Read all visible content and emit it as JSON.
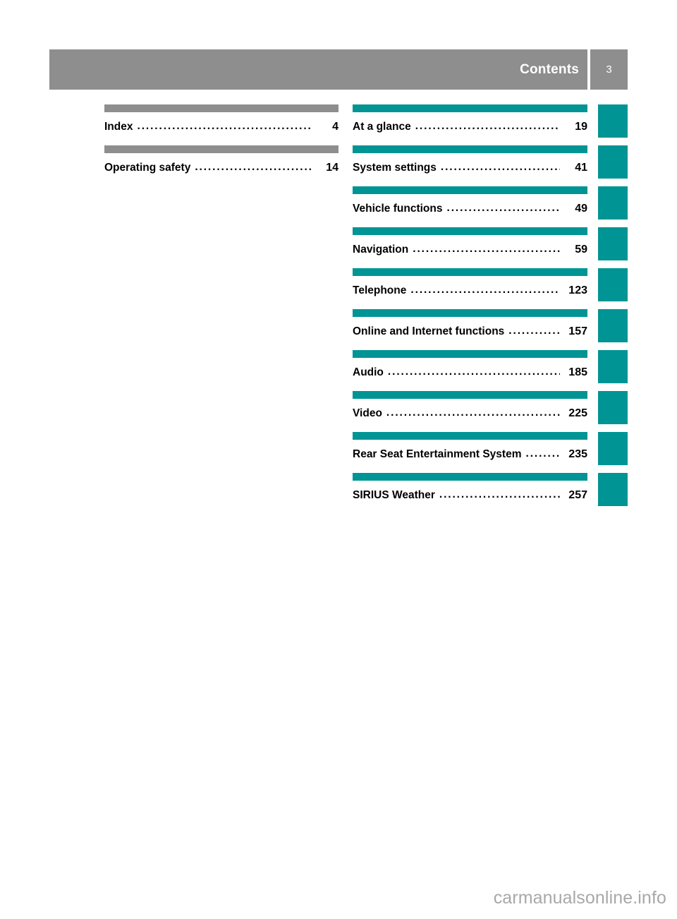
{
  "header": {
    "title": "Contents",
    "page_number": "3",
    "bar_color": "#8e8e8e",
    "text_color": "#ffffff"
  },
  "colors": {
    "gray_rule": "#8e8e8e",
    "teal_rule": "#009494",
    "tab_marker": "#009494",
    "text": "#000000",
    "watermark": "#a8a8a8"
  },
  "toc": {
    "dot_leader": "..............................................................",
    "left_column": [
      {
        "label": "Index",
        "page": "4",
        "rule_color": "#8e8e8e"
      },
      {
        "label": "Operating safety",
        "page": "14",
        "rule_color": "#8e8e8e"
      }
    ],
    "right_column": [
      {
        "label": "At a glance",
        "page": "19",
        "rule_color": "#009494"
      },
      {
        "label": "System settings",
        "page": "41",
        "rule_color": "#009494"
      },
      {
        "label": "Vehicle functions",
        "page": "49",
        "rule_color": "#009494"
      },
      {
        "label": "Navigation",
        "page": "59",
        "rule_color": "#009494"
      },
      {
        "label": "Telephone",
        "page": "123",
        "rule_color": "#009494"
      },
      {
        "label": "Online and Internet functions",
        "page": "157",
        "rule_color": "#009494"
      },
      {
        "label": "Audio",
        "page": "185",
        "rule_color": "#009494"
      },
      {
        "label": "Video",
        "page": "225",
        "rule_color": "#009494"
      },
      {
        "label": "Rear Seat Entertainment System",
        "page": "235",
        "rule_color": "#009494"
      },
      {
        "label": "SIRIUS Weather",
        "page": "257",
        "rule_color": "#009494"
      }
    ]
  },
  "tab_markers_count": 10,
  "footer": {
    "watermark": "carmanualsonline.info"
  }
}
